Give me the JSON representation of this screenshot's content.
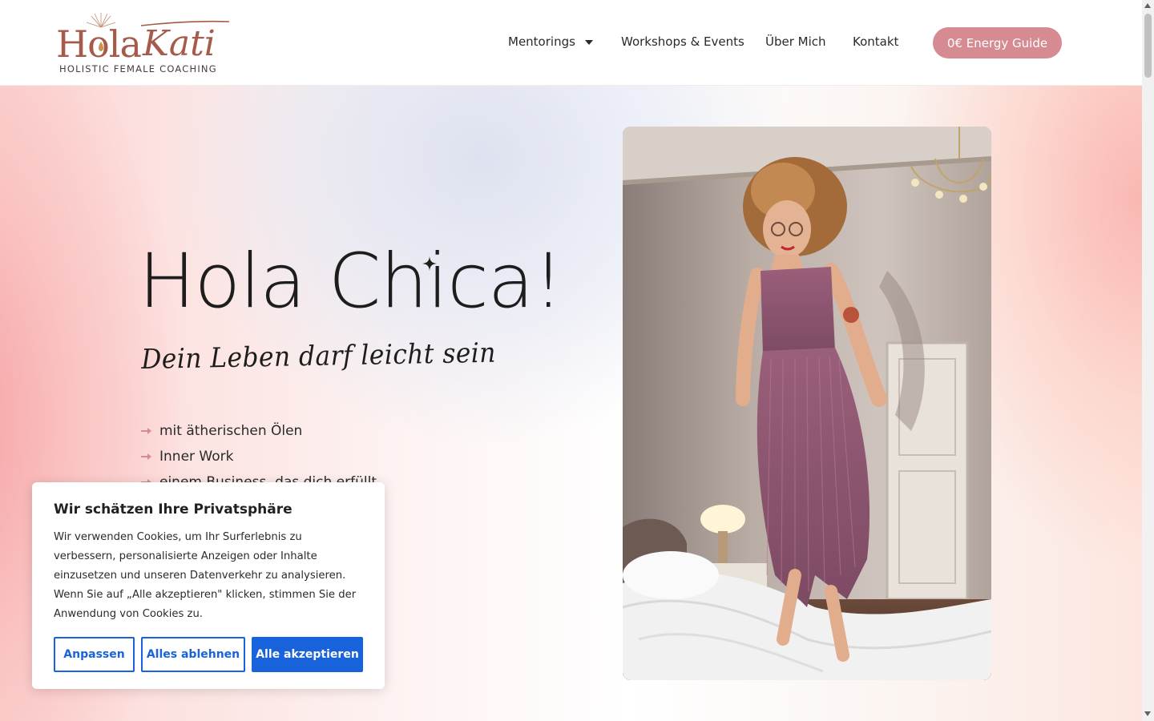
{
  "brand": {
    "logo_text": "HolaKati",
    "tagline": "HOLISTIC FEMALE COACHING"
  },
  "nav": {
    "items": [
      {
        "label": "Mentorings",
        "has_dropdown": true
      },
      {
        "label": "Workshops & Events"
      },
      {
        "label": "Über Mich"
      },
      {
        "label": "Kontakt"
      }
    ],
    "cta_label": "0€ Energy Guide"
  },
  "hero": {
    "title": "Hola Chica!",
    "subtitle": "Dein Leben darf leicht sein",
    "bullets": [
      "mit ätherischen Ölen",
      "Inner Work",
      "einem Business, das dich erfüllt"
    ],
    "photo_alt": "woman-jumping-on-bed"
  },
  "cookie": {
    "title": "Wir schätzen Ihre Privatsphäre",
    "text": "Wir verwenden Cookies, um Ihr Surferlebnis zu verbessern, personalisierte Anzeigen oder Inhalte einzusetzen und unseren Datenverkehr zu analysieren. Wenn Sie auf „Alle akzeptieren\" klicken, stimmen Sie der Anwendung von Cookies zu.",
    "customize_label": "Anpassen",
    "reject_label": "Alles ablehnen",
    "accept_label": "Alle akzeptieren"
  },
  "colors": {
    "cta": "#d58b91",
    "brand": "#a65a4a",
    "cookie_primary": "#1863dc",
    "arrow": "#d58b91"
  },
  "icons": [
    "logo-mark",
    "chevron-down-icon",
    "arrow-right-icon",
    "sparkle-icon"
  ]
}
